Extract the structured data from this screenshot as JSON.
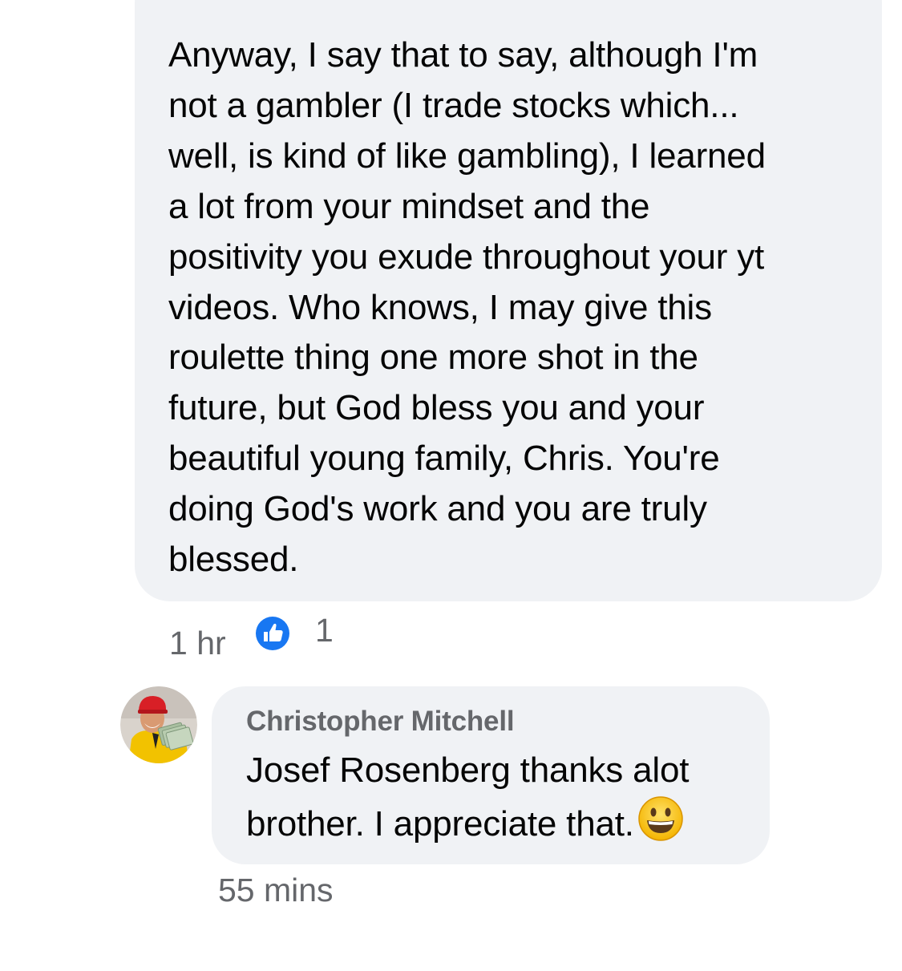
{
  "comment": {
    "lines": [
      "Anyway, I say that to say, although I'm",
      "not a gambler (I trade stocks which...",
      "well, is kind of like gambling), I learned",
      "a lot from your mindset and the",
      "positivity you exude throughout your yt",
      "videos. Who knows, I may give this",
      "roulette thing one more shot in the",
      "future, but God bless you and your",
      "beautiful young family, Chris. You're",
      "doing God's work and you are truly",
      "blessed."
    ],
    "time": "1 hr",
    "like_count": "1",
    "like_icon": "like-thumbs-up-icon"
  },
  "reply": {
    "author": "Christopher Mitchell",
    "lines": [
      "Josef Rosenberg thanks alot",
      "brother. I appreciate that."
    ],
    "emoji": "grinning-face-emoji",
    "time": "55 mins"
  },
  "colors": {
    "bubble_bg": "#f0f2f5",
    "text": "#050505",
    "meta_text": "#65676b",
    "like_blue": "#1877f2"
  }
}
